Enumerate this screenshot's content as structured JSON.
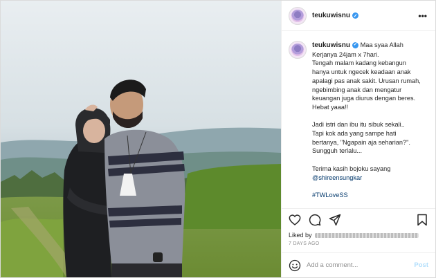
{
  "post": {
    "username": "teukuwisnu",
    "verified_mark": "✓",
    "more_icon": "•••",
    "caption": {
      "lines": [
        "Maa syaa Allah",
        "Kerjanya 24jam x 7hari.",
        "Tengah malam kadang kebangun",
        "hanya untuk ngecek keadaan anak",
        "apalagi pas anak sakit. Urusan rumah,",
        "ngebimbing anak dan mengatur",
        "keuangan juga diurus dengan beres.",
        "Hebat yaaa!!",
        "Jadi istri dan ibu itu sibuk sekali..",
        "Tapi kok ada yang sampe hati",
        "bertanya, \"Ngapain aja seharian?\".",
        "Sungguh terlalu...",
        "Terima kasih bojoku sayang",
        "@shireensungkar",
        "#TWLoveSS"
      ]
    },
    "likes_prefix": "Liked by",
    "time_ago": "7 DAYS AGO",
    "comment_placeholder": "Add a comment...",
    "post_button": "Post"
  },
  "icons": {
    "like": "heart-icon",
    "comment": "comment-icon",
    "share": "paper-plane-icon",
    "save": "bookmark-icon",
    "emoji": "smiley-icon"
  },
  "colors": {
    "link": "#00376b",
    "verified": "#3897f0",
    "post_button_disabled": "#b2dffc",
    "muted": "#8e8e8e"
  }
}
